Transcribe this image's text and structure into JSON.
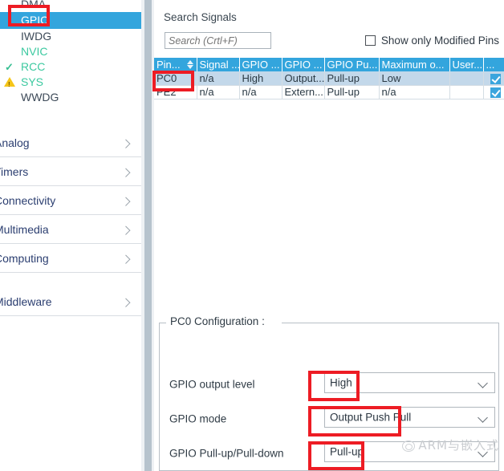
{
  "sidebar": {
    "peripherals": [
      {
        "label": "DMA",
        "state": "normal",
        "icon": "none"
      },
      {
        "label": "GPIO",
        "state": "selected",
        "icon": "none"
      },
      {
        "label": "IWDG",
        "state": "normal",
        "icon": "none"
      },
      {
        "label": "NVIC",
        "state": "green",
        "icon": "none"
      },
      {
        "label": "RCC",
        "state": "green",
        "icon": "check-icon"
      },
      {
        "label": "SYS",
        "state": "green",
        "icon": "warning-icon"
      },
      {
        "label": "WWDG",
        "state": "normal",
        "icon": "none"
      }
    ],
    "categories": [
      {
        "label": "Analog",
        "chevron": "chevron-right-icon"
      },
      {
        "label": "Timers",
        "chevron": "chevron-right-icon"
      },
      {
        "label": "Connectivity",
        "chevron": "chevron-right-icon"
      },
      {
        "label": "Multimedia",
        "chevron": "chevron-right-icon"
      },
      {
        "label": "Computing",
        "chevron": "chevron-right-icon"
      },
      {
        "label": "Middleware",
        "chevron": "chevron-right-icon"
      }
    ]
  },
  "search": {
    "label": "Search Signals",
    "placeholder": "Search (Crtl+F)",
    "value": ""
  },
  "modified_pins": {
    "label": "Show only Modified Pins",
    "checked": false
  },
  "table": {
    "columns": [
      "Pin...",
      "Signal ...",
      "GPIO ...",
      "GPIO ...",
      "GPIO Pu...",
      "Maximum o...",
      "User...",
      "..."
    ],
    "sort_column": "Pin...",
    "sort_icon": "sort-arrow-icon",
    "rows": [
      {
        "selected": true,
        "cells": [
          "PC0",
          "n/a",
          "High",
          "Output...",
          "Pull-up",
          "Low",
          ""
        ],
        "checked": true
      },
      {
        "selected": false,
        "cells": [
          "PE2",
          "n/a",
          "n/a",
          "Extern...",
          "Pull-up",
          "n/a",
          ""
        ],
        "checked": true
      }
    ]
  },
  "config": {
    "title": "PC0 Configuration :",
    "fields": [
      {
        "label": "GPIO output level",
        "value": "High",
        "dropdown_icon": "chevron-down-icon"
      },
      {
        "label": "GPIO mode",
        "value": "Output Push Pull",
        "dropdown_icon": "chevron-down-icon"
      },
      {
        "label": "GPIO Pull-up/Pull-down",
        "value": "Pull-up",
        "dropdown_icon": "chevron-down-icon"
      }
    ]
  },
  "watermark": {
    "text": "ARM与嵌入式"
  },
  "colors": {
    "accent_blue": "#33a5dd",
    "selection_blue": "#c3d8ea",
    "green_text": "#3cc9a0",
    "annotation_red": "#ed1c24",
    "warning_yellow": "#f5c518"
  }
}
